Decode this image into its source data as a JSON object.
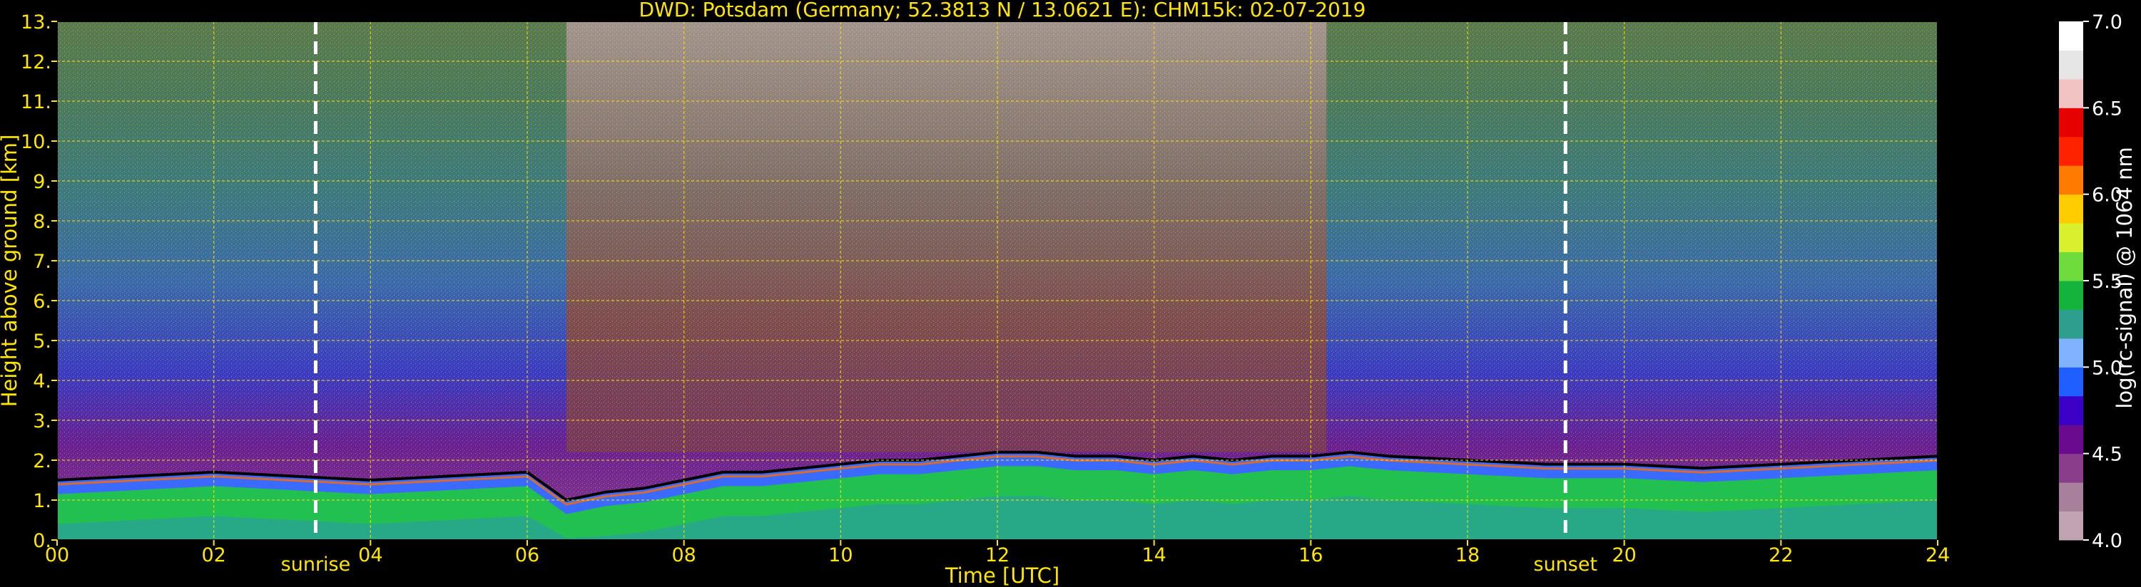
{
  "chart_data": {
    "type": "heatmap",
    "title": "DWD: Potsdam (Germany; 52.3813 N / 13.0621 E):    CHM15k: 02-07-2019",
    "xlabel": "Time [UTC]",
    "ylabel": "Height above ground [km]",
    "xlim": [
      0,
      24
    ],
    "ylim": [
      0,
      13
    ],
    "x_ticks": [
      "00",
      "02",
      "04",
      "06",
      "08",
      "10",
      "12",
      "14",
      "16",
      "18",
      "20",
      "22",
      "24"
    ],
    "y_ticks": [
      "0.",
      "1.",
      "2.",
      "3.",
      "4.",
      "5.",
      "6.",
      "7.",
      "8.",
      "9.",
      "10.",
      "11.",
      "12.",
      "13."
    ],
    "grid": true,
    "colorbar": {
      "label": "log(rc-signal) @ 1064 nm",
      "range": [
        4.0,
        7.0
      ],
      "ticks": [
        "4.0",
        "4.5",
        "5.0",
        "5.5",
        "6.0",
        "6.5",
        "7.0"
      ]
    },
    "annotations": [
      {
        "label": "sunrise",
        "x": 3.3
      },
      {
        "label": "sunset",
        "x": 19.25
      }
    ],
    "boundary_layer_top_km": {
      "x": [
        0,
        1,
        2,
        3,
        4,
        5,
        6,
        6.5,
        7,
        7.5,
        8,
        8.5,
        9,
        9.5,
        10,
        10.5,
        11,
        11.5,
        12,
        12.5,
        13,
        13.5,
        14,
        14.5,
        15,
        15.5,
        16,
        16.5,
        17,
        18,
        19,
        20,
        21,
        22,
        23,
        24
      ],
      "y": [
        1.5,
        1.6,
        1.7,
        1.6,
        1.5,
        1.6,
        1.7,
        1.0,
        1.2,
        1.3,
        1.5,
        1.7,
        1.7,
        1.8,
        1.9,
        2.0,
        2.0,
        2.1,
        2.2,
        2.2,
        2.1,
        2.1,
        2.0,
        2.1,
        2.0,
        2.1,
        2.1,
        2.2,
        2.1,
        2.0,
        1.9,
        1.9,
        1.8,
        1.9,
        2.0,
        2.1
      ]
    }
  },
  "colors": {
    "text": "#ffe600",
    "grid": "#ffe600",
    "background": "#000000",
    "colormap": [
      "#c2a3b4",
      "#a8809b",
      "#8a3d8a",
      "#6a0a8f",
      "#3a00c8",
      "#1f5eff",
      "#7fb2ff",
      "#2e9e8e",
      "#14b43c",
      "#6edc3c",
      "#d8f02e",
      "#ffcc00",
      "#ff7a00",
      "#ff2200",
      "#e60000",
      "#f2c3c3",
      "#e6e6e6",
      "#ffffff"
    ]
  }
}
